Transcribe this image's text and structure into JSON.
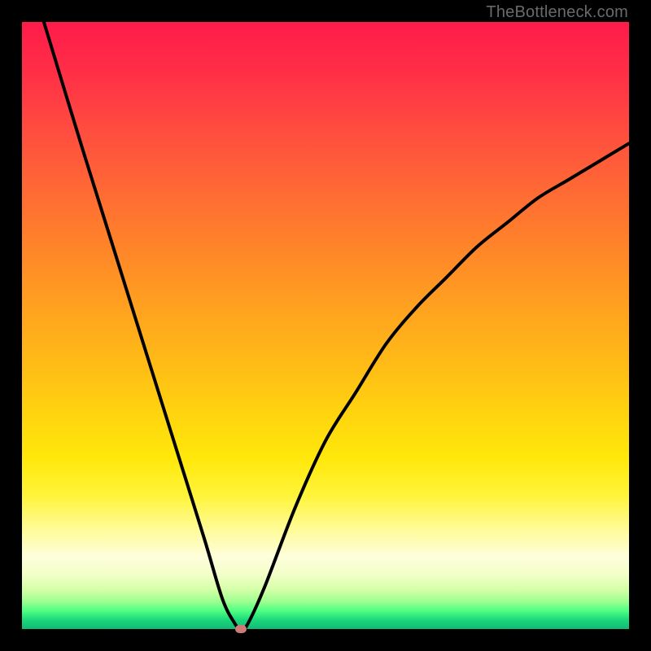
{
  "attribution": "TheBottleneck.com",
  "chart_data": {
    "type": "line",
    "title": "",
    "xlabel": "",
    "ylabel": "",
    "ylim": [
      0,
      100
    ],
    "xlim": [
      0,
      100
    ],
    "series": [
      {
        "name": "bottleneck-curve",
        "x": [
          3.6,
          10,
          15,
          20,
          25,
          30,
          33,
          35,
          36,
          37,
          40,
          45,
          50,
          55,
          60,
          65,
          70,
          75,
          80,
          85,
          90,
          95,
          100
        ],
        "values": [
          100,
          79,
          63,
          47,
          31,
          15,
          5,
          1,
          0,
          0.5,
          7,
          20,
          31,
          39,
          47,
          53,
          58,
          63,
          67,
          71,
          74,
          77,
          80
        ]
      }
    ],
    "minimum_marker": {
      "x": 36,
      "y": 0
    },
    "gradient_stops": [
      {
        "pos": 0,
        "color": "#ff1b4a"
      },
      {
        "pos": 0.5,
        "color": "#ffa41e"
      },
      {
        "pos": 0.78,
        "color": "#fff43a"
      },
      {
        "pos": 0.9,
        "color": "#fefedb"
      },
      {
        "pos": 1.0,
        "color": "#12b877"
      }
    ]
  }
}
